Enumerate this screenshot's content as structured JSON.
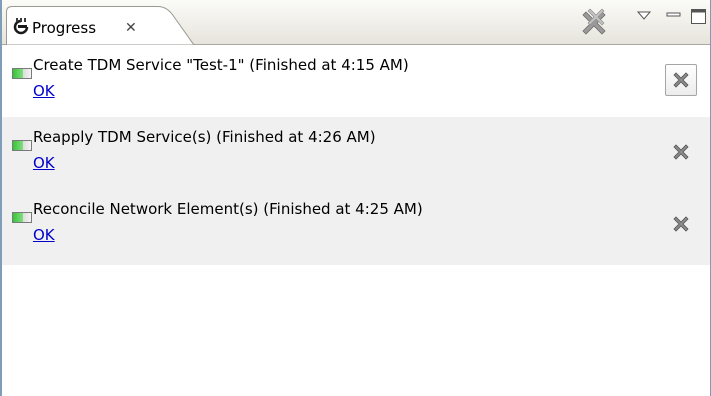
{
  "view": {
    "tab_label": "Progress",
    "tab_icon": "progress-view-icon",
    "close_icon": "close-x-icon",
    "toolbar": [
      {
        "name": "remove-all-finished-icon"
      },
      {
        "name": "view-menu-chevron-icon"
      },
      {
        "name": "minimize-icon"
      },
      {
        "name": "maximize-icon"
      }
    ]
  },
  "jobs": [
    {
      "title": "Create TDM Service \"Test-1\" (Finished at 4:15 AM)",
      "status": "OK",
      "icon": "progress-bar-icon",
      "remove_icon": "remove-icon"
    },
    {
      "title": "Reapply TDM Service(s) (Finished at 4:26 AM)",
      "status": "OK",
      "icon": "progress-bar-icon",
      "remove_icon": "remove-icon"
    },
    {
      "title": "Reconcile Network Element(s) (Finished at 4:25 AM)",
      "status": "OK",
      "icon": "progress-bar-icon",
      "remove_icon": "remove-icon"
    }
  ],
  "colors": {
    "link": "#0000cc",
    "alt_row": "#f0f0f0",
    "border": "#7f9db9"
  }
}
